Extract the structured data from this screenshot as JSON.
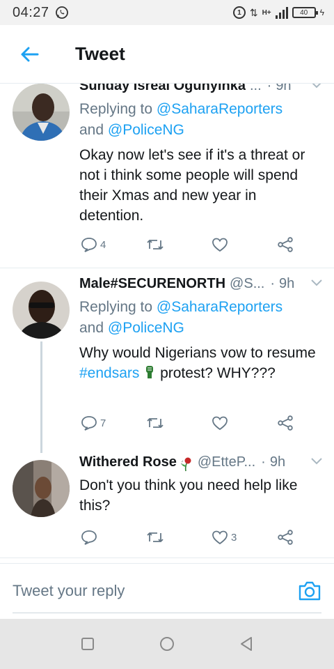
{
  "status_bar": {
    "time": "04:27",
    "battery": "40",
    "network": "H+",
    "sim_badge": "1"
  },
  "header": {
    "title": "Tweet"
  },
  "tweets": [
    {
      "name": "Sunday Isreal Ogunyinka",
      "handle": "...",
      "time": "9h",
      "replying_prefix": "Replying to ",
      "replying_to_1": "@SaharaReporters",
      "replying_and": "and ",
      "replying_to_2": "@PoliceNG",
      "text": "Okay now let's see if it's a threat or not i think some people will spend their Xmas and new year in detention.",
      "reply_count": "4",
      "retweet_count": "",
      "like_count": ""
    },
    {
      "name": "Male#SECURENORTH",
      "handle": "@S...",
      "time": "9h",
      "replying_prefix": "Replying to ",
      "replying_to_1": "@SaharaReporters",
      "replying_and": "and ",
      "replying_to_2": "@PoliceNG",
      "text_before": "Why would Nigerians vow to resume ",
      "hashtag": "#endsars",
      "text_after": " protest? WHY???",
      "reply_count": "7",
      "retweet_count": "",
      "like_count": ""
    },
    {
      "name": "Withered Rose",
      "handle": "@EtteP...",
      "time": "9h",
      "text": "Don't you think you need help like this?",
      "reply_count": "",
      "retweet_count": "",
      "like_count": "3"
    }
  ],
  "reply_bar": {
    "placeholder": "Tweet your reply"
  },
  "colors": {
    "accent": "#1da1f2",
    "secondary_text": "#657786",
    "divider": "#e6ecf0"
  },
  "icons": [
    "back-arrow-icon",
    "chevron-down-icon",
    "reply-icon",
    "retweet-icon",
    "like-icon",
    "share-icon",
    "camera-icon",
    "recents-icon",
    "home-icon",
    "back-icon"
  ]
}
